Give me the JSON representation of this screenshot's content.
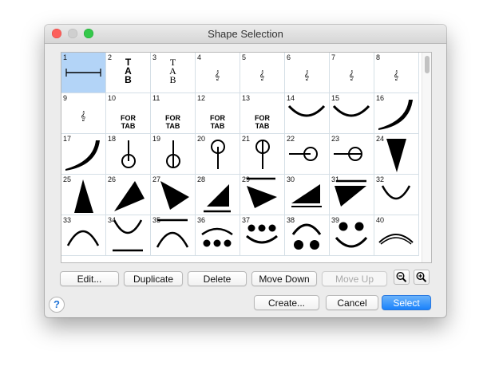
{
  "window": {
    "title": "Shape Selection"
  },
  "cells": [
    {
      "num": "1"
    },
    {
      "num": "2",
      "text": [
        "T",
        "A",
        "B"
      ]
    },
    {
      "num": "3",
      "text": [
        "T",
        "A",
        "B"
      ]
    },
    {
      "num": "4"
    },
    {
      "num": "5"
    },
    {
      "num": "6"
    },
    {
      "num": "7"
    },
    {
      "num": "8"
    },
    {
      "num": "9"
    },
    {
      "num": "10",
      "text": [
        "FOR",
        "TAB"
      ]
    },
    {
      "num": "11",
      "text": [
        "FOR",
        "TAB"
      ]
    },
    {
      "num": "12",
      "text": [
        "FOR",
        "TAB"
      ]
    },
    {
      "num": "13",
      "text": [
        "FOR",
        "TAB"
      ]
    },
    {
      "num": "14"
    },
    {
      "num": "15"
    },
    {
      "num": "16"
    },
    {
      "num": "17"
    },
    {
      "num": "18"
    },
    {
      "num": "19"
    },
    {
      "num": "20"
    },
    {
      "num": "21"
    },
    {
      "num": "22"
    },
    {
      "num": "23"
    },
    {
      "num": "24"
    },
    {
      "num": "25"
    },
    {
      "num": "26"
    },
    {
      "num": "27"
    },
    {
      "num": "28"
    },
    {
      "num": "29"
    },
    {
      "num": "30"
    },
    {
      "num": "31"
    },
    {
      "num": "32"
    },
    {
      "num": "33"
    },
    {
      "num": "34"
    },
    {
      "num": "35"
    },
    {
      "num": "36"
    },
    {
      "num": "37"
    },
    {
      "num": "38"
    },
    {
      "num": "39"
    },
    {
      "num": "40"
    }
  ],
  "selected_cell": "1",
  "toolbar": {
    "edit": "Edit...",
    "duplicate": "Duplicate",
    "delete": "Delete",
    "move_down": "Move Down",
    "move_up": "Move Up"
  },
  "footer": {
    "help": "?",
    "create": "Create...",
    "cancel": "Cancel",
    "select": "Select"
  },
  "colors": {
    "accent": "#1a82fb",
    "selection": "#b3d4f7",
    "close": "#fc605c",
    "zoom": "#34c84a"
  },
  "icons": {
    "zoom_out": "zoom-out-icon",
    "zoom_in": "zoom-in-icon"
  }
}
